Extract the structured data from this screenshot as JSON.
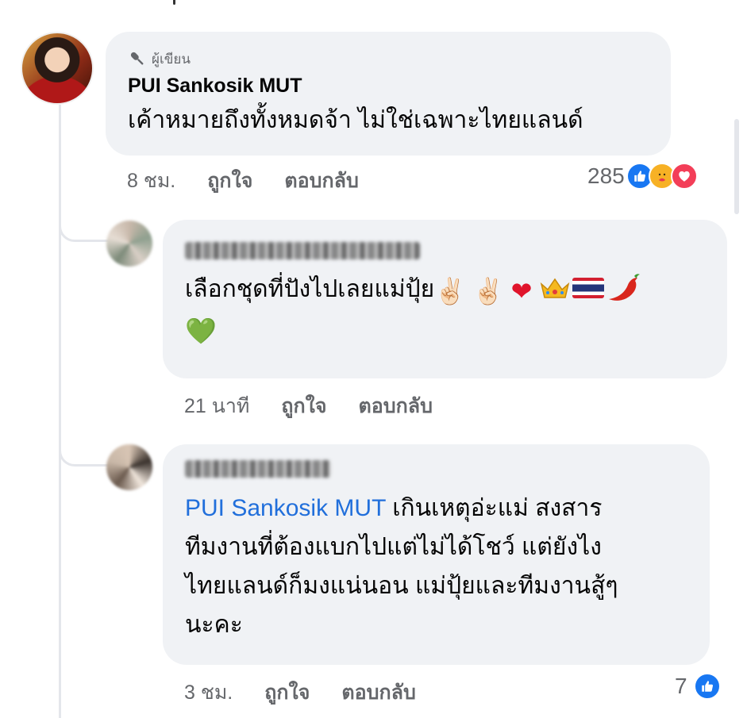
{
  "comment1": {
    "author_badge": "ผู้เขียน",
    "name": "PUI Sankosik MUT",
    "text": "เค้าหมายถึงทั้งหมดจ้า ไม่ใช่เฉพาะไทยแลนด์",
    "time": "8 ชม.",
    "like_label": "ถูกใจ",
    "reply_label": "ตอบกลับ",
    "reaction_count": "285",
    "reactions": [
      "like-icon",
      "care-icon",
      "love-icon"
    ]
  },
  "comment2": {
    "text": "เลือกชุดที่ปังไปเลยแม่ปุ้ย",
    "emojis": {
      "victory": "✌🏻",
      "heart_red": "❤",
      "heart_green": "💚"
    },
    "time": "21 นาที",
    "like_label": "ถูกใจ",
    "reply_label": "ตอบกลับ"
  },
  "comment3": {
    "mention": "PUI Sankosik MUT",
    "text_line1": " เกินเหตุอ่ะแม่  สงสาร",
    "text_line2": "ทีมงานที่ต้องแบกไปแต่ไม่ได้โชว์  แต่ยังไง",
    "text_line3": "ไทยแลนด์ก็มงแน่นอน  แม่ปุ้ยและทีมงานสู้ๆ",
    "text_line4": "นะคะ",
    "time": "3 ชม.",
    "like_label": "ถูกใจ",
    "reply_label": "ตอบกลับ",
    "reaction_count": "7",
    "reactions": [
      "like-icon"
    ]
  },
  "colors": {
    "bubble_bg": "#f0f2f5",
    "mention": "#216fdb",
    "like_blue": "#1877f2",
    "love_red": "#f33e58",
    "care_yellow": "#f7b125",
    "meta_gray": "#65676b"
  }
}
